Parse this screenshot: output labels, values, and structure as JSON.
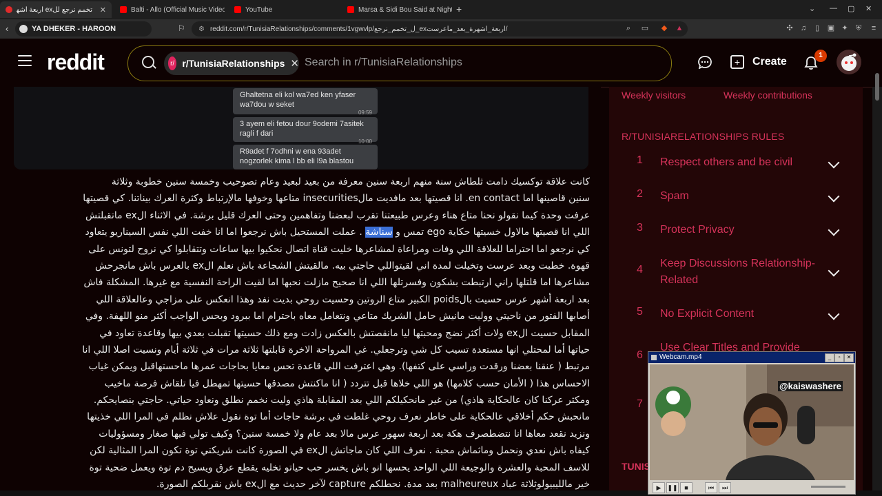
{
  "browser": {
    "tabs": [
      {
        "title": "تخمم نرجع للex اربعة اشهرة بعد",
        "active": true
      },
      {
        "title": "Balti - Allo (Official Music Video) - Yo",
        "active": false
      },
      {
        "title": "YouTube",
        "active": false
      },
      {
        "title": "Marsa & Sidi Bou Said at Night 🌙 |",
        "active": false
      }
    ],
    "profile_label": "YA DHEKER - HAROON",
    "url": "reddit.com/r/TunisiaRelationships/comments/1vgwvlp/ل_تخمم_نرجع_exاربعة_اشهرة_بعد_ماعرست/"
  },
  "header": {
    "logo": "reddit",
    "subreddit_chip": "r/TunisiaRelationships",
    "search_placeholder": "Search in r/TunisiaRelationships",
    "create_label": "Create",
    "notification_count": "1"
  },
  "chat_image": {
    "messages": [
      {
        "text": "Ghaltetna eli kol wa7ed ken yfaser wa7dou w seket",
        "time": "09:59"
      },
      {
        "text": "3 ayem eli fetou dour 9odemi 7asitek ragli f dari",
        "time": "10:00"
      },
      {
        "text": "R9adet f 7odhni w ena 93adet nogzorlek kima l bb eli l9a blastou",
        "time": ""
      }
    ]
  },
  "post": {
    "lines": [
      "كانت علاقة توكسيك دامت ثلطاش سنة منهم اربعة سنين معرفة من بعيد لبعيد وعام تصوحيب وخمسة سنين خطوبة وثلاثة",
      "سنين قاصينها اما en contact. انا قصيتها بعد مافديت مالinsecurities متاعها وخوفها مالإرتباط وكثرة العرك بيناتنا. كي قصيتها",
      "عرفت وحدة كيما نقولو نحنا متاع هناء وعرس طبيعتنا تقرب لبعضنا وتفاهمين وحتى العرك قليل برشة. في الاثناء الex ماتقبلتش",
      "اللي انا قصيتها مالاول خسيتها حكاية ego تمس و",
      "كي نرجعو اما احتراما للعلاقة اللي وفات ومراعاة لمشاعرها خليت قناة اتصال نحكيوا بيها ساعات وتتقابلوا كي نروح لتونس على",
      "قهوة. خطبت وبعد عرست وتخيلت لمدة اني لقيتواللي حاجتي بيه. مالقيتش الشجاعة باش نعلم الex بالعرس باش مانجرحش",
      "مشاعرها اما قلتلها راني ارتبطت بشكون وفسرتلها اللي انا صحيح مازلت نحبها اما لقيت الراحة النفسية مع غيرها. المشكلة فاش",
      "بعد اربعة أشهر عرس حسيت بالpoids الكبير متاع الروتين وحسيت روحي بديت نفد وهذا انعكس على مزاجي وعالعلاقة اللي",
      "أصابها الفتور من ناحيتي ووليت مانيش حامل الشريك متاعي ونتعامل معاه باحترام اما ببرود وبحس الواجب أكثر منو اللهفة. وفي",
      "المقابل حسيت الex ولات أكثر نضج ومحبتها ليا مانقصتش بالعكس زادت ومع ذلك حسيتها تقبلت بعدي بيها وقاعدة تعاود في",
      "حياتها أما لمحتلي انها مستعدة تسيب كل شي وترجعلي. غي المرواحة الاخرة قابلتها ثلاثة مرات في ثلاثة أيام ونسيت اصلا اللي انا",
      "مرتبط ( عنقنا بعضنا ورقدت وراسي على كتفها). وهي اعترفت اللي قاعدة تحس معايا بحاجات عمرها ماحستهاقبل ويمكن غياب",
      "الاحساس هذا ( الأمان حسب كلامها) هو اللي خلاها قبل تتردد ( انا ماكنتش مصدقها حسيتها تمهطل فيا تلقاش فرصة ماخيب",
      "ومكثر عركنا كان عالحكاية هاذي) من غير مانحكيلكم اللي بعد المقابلة هاذي وليت نخمم نطلق ونعاود حياتي. حاجتي بنصايحكم.",
      "مانحبش حكم أخلاقي عالحكاية على خاطر نعرف روحي غلطت في برشة حاجات أما توة نقول علاش نظلم في المرا اللي خذيتها",
      "ونزيد نقعد معاها انا نتضطصرف هكة بعد اربعة سهور عرس مالا بعد عام ولا خمسة سنين؟ وكيف تولي فيها صغار ومسؤوليات",
      "كيفاه باش نعدي ونحمل وماثماش محبة . نعرف اللي كان ماجاتش الex في الصورة كانت شريكتي توة تكون المرا المثالية لكن",
      "للاسف المحبة والعشرة والوجيعة اللي الواحد يحسها انو باش يخسر حب حياتو تخليه يقطع عرق ويسيح دم توة ويعمل ضحية توة",
      "خير مالليبيولوثلاثة عباد malheureux بعد مدة. نحطلكم capture لآخر حديث مع الex باش نقربلكم الصورة."
    ],
    "line4_highlight": "سناشة",
    "line4_tail": "عملت المستحيل باش نرجعوا اما انا خفت اللي نفس السيناريو يتعاود"
  },
  "sidebar": {
    "stats": [
      "Weekly visitors",
      "Weekly contributions"
    ],
    "rules_title": "R/TUNISIARELATIONSHIPS RULES",
    "rules": [
      {
        "num": "1",
        "text": "Respect others and be civil"
      },
      {
        "num": "2",
        "text": "Spam"
      },
      {
        "num": "3",
        "text": "Protect Privacy"
      },
      {
        "num": "4",
        "text": "Keep Discussions Relationship-Related"
      },
      {
        "num": "5",
        "text": "No Explicit Content"
      },
      {
        "num": "6",
        "text": "Use Clear Titles and Provide"
      },
      {
        "num": "7",
        "text": ""
      }
    ],
    "bottom_label": "TUNIS"
  },
  "webcam": {
    "title": "Webcam.mp4",
    "handle": "@kaiswashere"
  },
  "colors": {
    "accent": "#d6335a",
    "page_bg": "#0e0202",
    "sidebar_bg": "#230607",
    "notification_badge": "#d93a00"
  }
}
